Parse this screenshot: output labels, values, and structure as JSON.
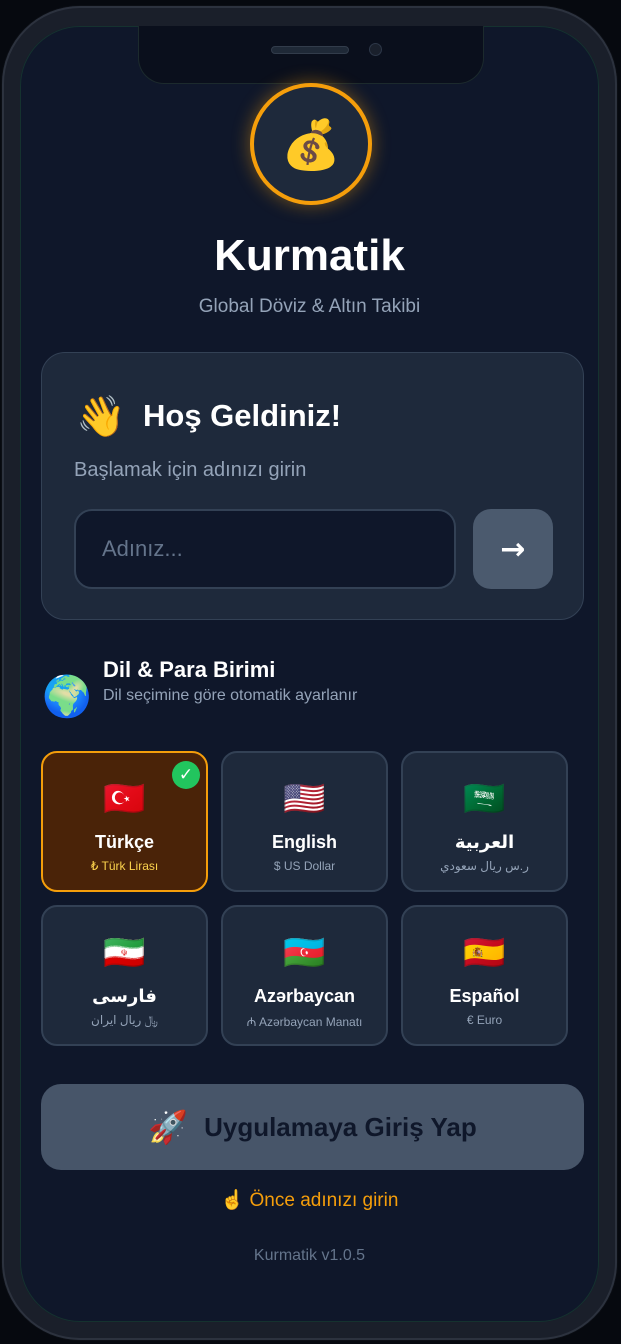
{
  "app": {
    "logo_icon": "💰",
    "title": "Kurmatik",
    "subtitle": "Global Döviz & Altın Takibi",
    "version": "Kurmatik v1.0.5"
  },
  "welcome": {
    "icon": "👋",
    "title": "Hoş Geldiniz!",
    "subtitle": "Başlamak için adınızı girin",
    "input_value": "",
    "input_placeholder": "Adınız...",
    "submit_icon": "→"
  },
  "language_section": {
    "icon": "🌍",
    "title": "Dil & Para Birimi",
    "subtitle": "Dil seçimine göre otomatik ayarlanır",
    "selected_check": "✓",
    "options": [
      {
        "flag": "🇹🇷",
        "name": "Türkçe",
        "currency": "₺ Türk Lirası",
        "selected": true
      },
      {
        "flag": "🇺🇸",
        "name": "English",
        "currency": "$ US Dollar",
        "selected": false
      },
      {
        "flag": "🇸🇦",
        "name": "العربية",
        "currency": "ر.س ريال سعودي",
        "selected": false
      },
      {
        "flag": "🇮🇷",
        "name": "فارسی",
        "currency": "﷼ ریال ایران",
        "selected": false
      },
      {
        "flag": "🇦🇿",
        "name": "Azərbaycan",
        "currency": "₼ Azərbaycan Manatı",
        "selected": false
      },
      {
        "flag": "🇪🇸",
        "name": "Español",
        "currency": "€ Euro",
        "selected": false
      }
    ]
  },
  "enter": {
    "icon": "🚀",
    "label": "Uygulamaya Giriş Yap"
  },
  "hint": "☝️ Önce adınızı girin",
  "colors": {
    "background": "#0f172a",
    "card": "#1e293b",
    "accent": "#f59e0b",
    "selected_tile": "#4a2308",
    "success": "#22c55e",
    "button_disabled": "#475569"
  }
}
